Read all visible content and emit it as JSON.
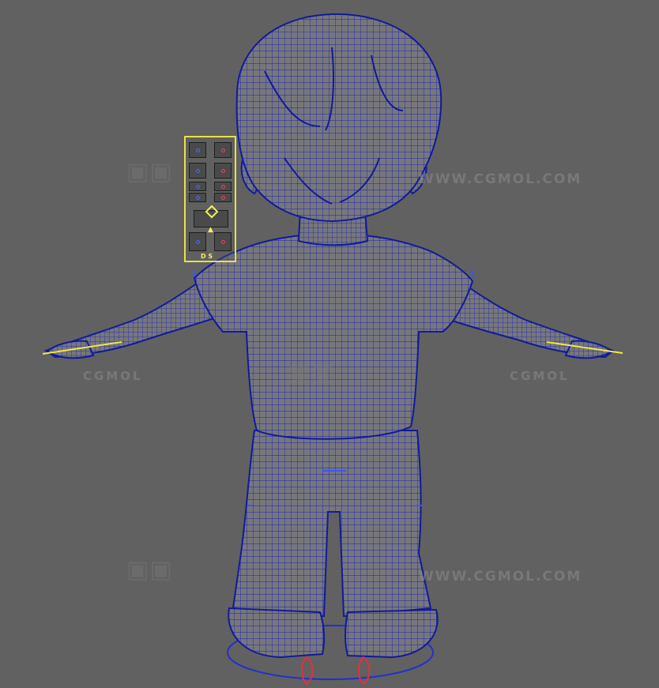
{
  "viewport": {
    "background": "#616161",
    "mesh_color": "#1a1fb0",
    "skin_color": "#7a7a7d",
    "selection_color": "#e6e24a"
  },
  "watermarks": {
    "url_top": "WWW.CGMOL.COM",
    "url_bottom": "WWW.CGMOL.COM",
    "brand_left": "CGMOL",
    "brand_right": "CGMOL"
  },
  "rig_panel": {
    "arrow_glyph": "▲",
    "bottom_label": "D S"
  }
}
